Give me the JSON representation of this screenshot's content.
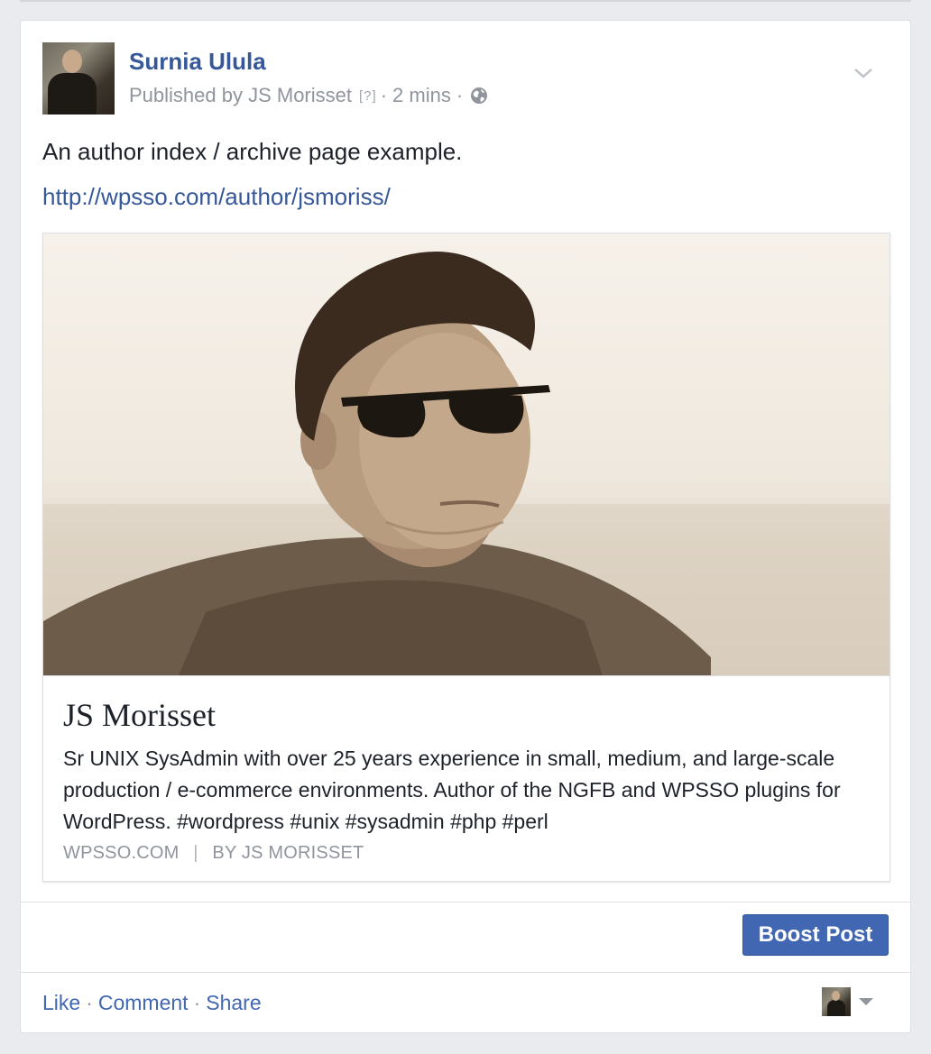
{
  "post": {
    "page_name": "Surnia Ulula",
    "published_by": "Published by JS Morisset",
    "help_badge": "[?]",
    "separator": "·",
    "time": "2 mins",
    "audience_icon": "globe-icon",
    "menu_icon": "chevron-down-icon",
    "text": "An author index / archive page example.",
    "link": "http://wpsso.com/author/jsmoriss/"
  },
  "link_preview": {
    "title": "JS Morisset",
    "description": "Sr UNIX SysAdmin with over 25 years experience in small, medium, and large-scale production / e-commerce environments. Author of the NGFB and WPSSO plugins for WordPress. #wordpress #unix #sysadmin #php #perl",
    "domain": "WPSSO.COM",
    "domain_separator": "|",
    "byline": "BY JS MORISSET"
  },
  "boost": {
    "label": "Boost Post",
    "color": "#4267b2"
  },
  "actions": {
    "like": "Like",
    "comment": "Comment",
    "share": "Share",
    "separator": "·"
  },
  "colors": {
    "link_blue": "#365899",
    "meta_gray": "#90949c",
    "text": "#1d2129"
  }
}
